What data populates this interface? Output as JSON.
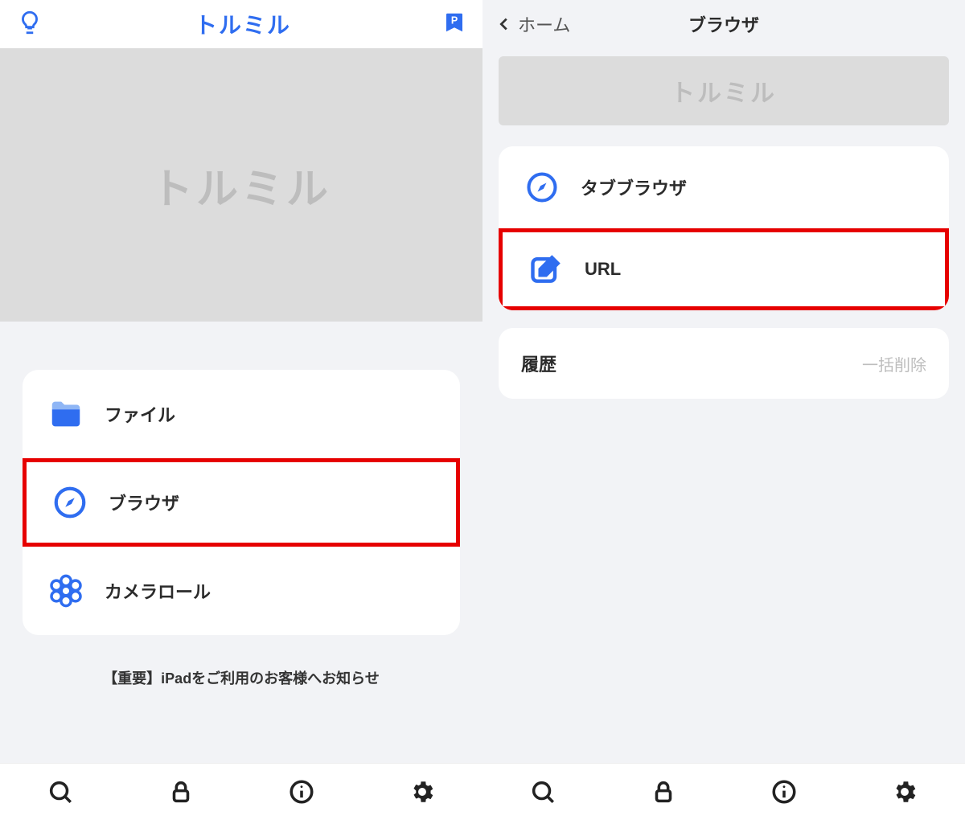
{
  "left": {
    "app_title": "トルミル",
    "banner_logo": "トルミル",
    "menu": [
      {
        "label": "ファイル",
        "icon": "folder",
        "highlight": false
      },
      {
        "label": "ブラウザ",
        "icon": "compass",
        "highlight": true
      },
      {
        "label": "カメラロール",
        "icon": "flower",
        "highlight": false
      }
    ],
    "notice": "【重要】iPadをご利用のお客様へお知らせ"
  },
  "right": {
    "back_label": "ホーム",
    "title": "ブラウザ",
    "banner_logo": "トルミル",
    "items": [
      {
        "label": "タブブラウザ",
        "icon": "compass",
        "highlight": false
      },
      {
        "label": "URL",
        "icon": "edit",
        "highlight": true
      }
    ],
    "history": {
      "label": "履歴",
      "action": "一括削除"
    }
  },
  "tabbar": [
    "search",
    "lock",
    "info",
    "settings"
  ]
}
